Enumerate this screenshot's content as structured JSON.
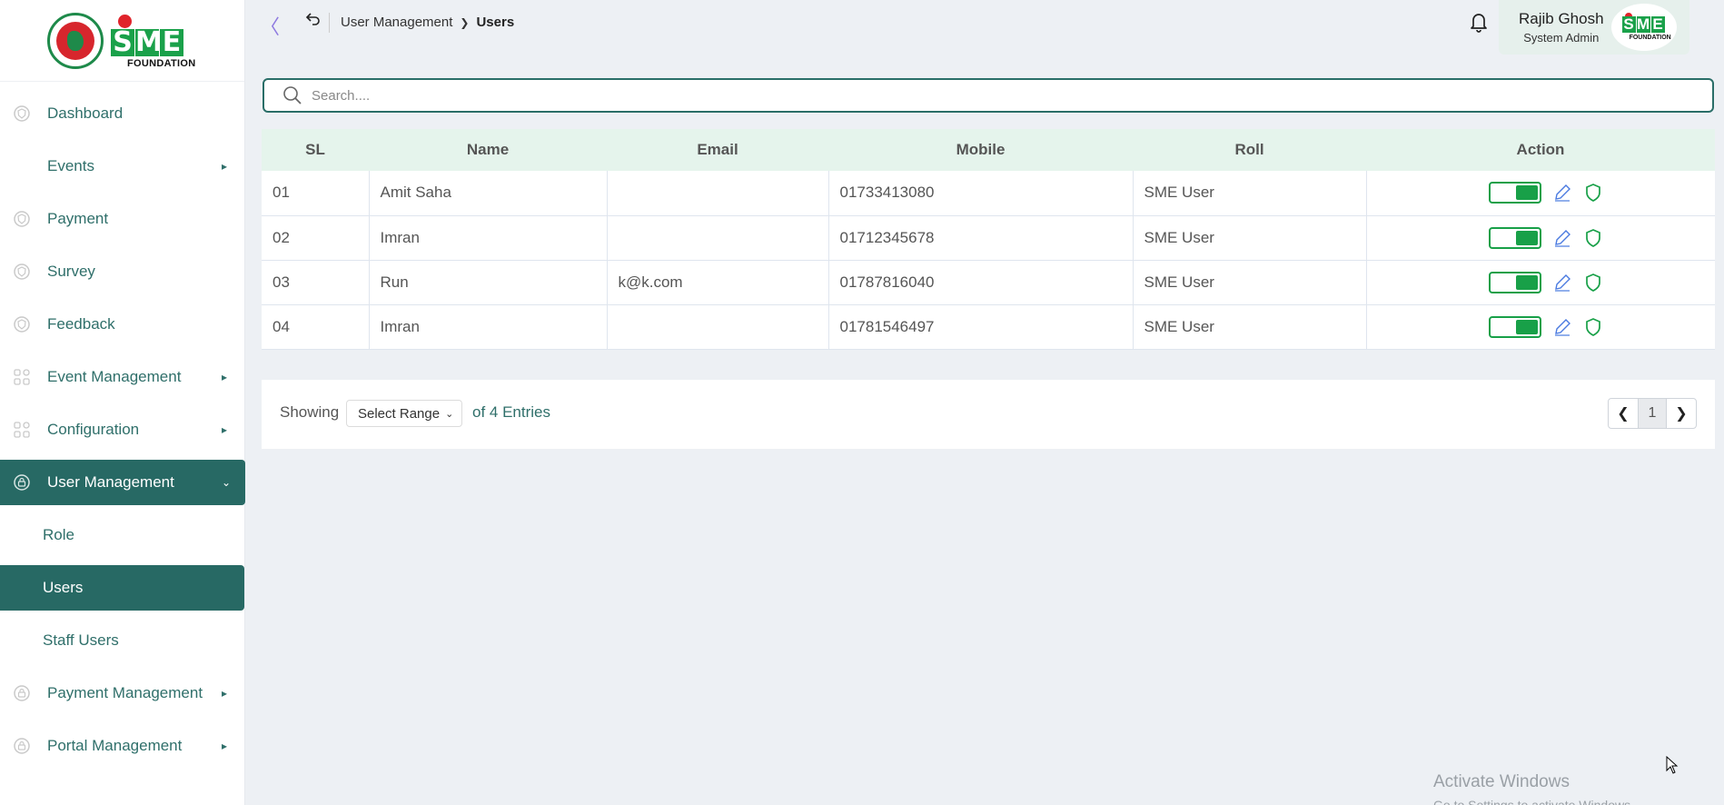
{
  "brand": {
    "foundation": "FOUNDATION",
    "letters": [
      "S",
      "M",
      "E"
    ]
  },
  "sidebar": {
    "items": [
      {
        "label": "Dashboard",
        "icon": "shield-badge-icon",
        "has_arrow": false
      },
      {
        "label": "Events",
        "icon": "",
        "has_arrow": true
      },
      {
        "label": "Payment",
        "icon": "shield-badge-icon",
        "has_arrow": false
      },
      {
        "label": "Survey",
        "icon": "shield-badge-icon",
        "has_arrow": false
      },
      {
        "label": "Feedback",
        "icon": "shield-badge-icon",
        "has_arrow": false
      },
      {
        "label": "Event Management",
        "icon": "grid-icon",
        "has_arrow": true
      },
      {
        "label": "Configuration",
        "icon": "grid-icon",
        "has_arrow": true
      },
      {
        "label": "User Management",
        "icon": "lock-icon",
        "has_arrow": true,
        "expanded": true
      },
      {
        "label": "Payment Management",
        "icon": "lock-icon",
        "has_arrow": true
      },
      {
        "label": "Portal Management",
        "icon": "lock-icon",
        "has_arrow": true
      }
    ],
    "sub_items": [
      "Role",
      "Users",
      "Staff Users"
    ],
    "active_sub": "Users"
  },
  "header": {
    "breadcrumb_parent": "User Management",
    "breadcrumb_current": "Users",
    "user_name": "Rajib Ghosh",
    "user_role": "System Admin"
  },
  "search": {
    "placeholder": "Search...."
  },
  "table": {
    "columns": [
      "SL",
      "Name",
      "Email",
      "Mobile",
      "Roll",
      "Action"
    ],
    "rows": [
      {
        "sl": "01",
        "name": "Amit Saha",
        "email": "",
        "mobile": "01733413080",
        "roll": "SME User",
        "active": true
      },
      {
        "sl": "02",
        "name": "Imran",
        "email": "",
        "mobile": "01712345678",
        "roll": "SME User",
        "active": true
      },
      {
        "sl": "03",
        "name": "Run",
        "email": "k@k.com",
        "mobile": "01787816040",
        "roll": "SME User",
        "active": true
      },
      {
        "sl": "04",
        "name": "Imran",
        "email": "",
        "mobile": "01781546497",
        "roll": "SME User",
        "active": true
      }
    ]
  },
  "pagination": {
    "showing": "Showing",
    "range_label": "Select Range",
    "entries": "of 4 Entries",
    "current_page": "1"
  },
  "watermark": {
    "title": "Activate Windows",
    "subtitle": "Go to Settings to activate Windows."
  },
  "colors": {
    "accent": "#276964",
    "toggle": "#18a048",
    "header_row": "#e5f4ec",
    "collapse": "#8e7ae0"
  }
}
